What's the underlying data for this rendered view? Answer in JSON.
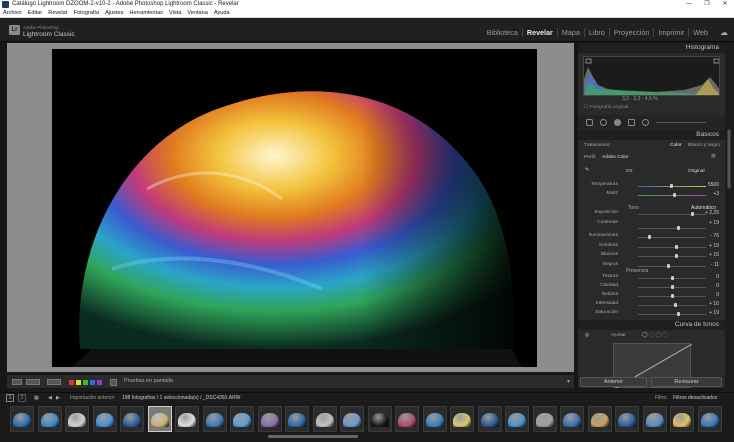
{
  "window": {
    "title": "Catálogo Lightroom DZOOM-2-v10-2 - Adobe Photoshop Lightroom Classic - Revelar",
    "controls": [
      "—",
      "❐",
      "✕"
    ]
  },
  "menu": [
    "Archivo",
    "Editar",
    "Revelar",
    "Fotografía",
    "Ajustes",
    "Herramientas",
    "Vista",
    "Ventana",
    "Ayuda"
  ],
  "identity": {
    "logo": "Lr",
    "vendor": "Adobe Photoshop",
    "product": "Lightroom Classic"
  },
  "modules": [
    {
      "label": "Biblioteca",
      "active": false
    },
    {
      "label": "Revelar",
      "active": true
    },
    {
      "label": "Mapa",
      "active": false
    },
    {
      "label": "Libro",
      "active": false
    },
    {
      "label": "Proyección",
      "active": false
    },
    {
      "label": "Imprimir",
      "active": false
    },
    {
      "label": "Web",
      "active": false
    }
  ],
  "histogram": {
    "title": "Histograma",
    "readout": "3,2   ·   3,3   ·   4,5 %",
    "original_photo": "Fotografía original"
  },
  "basic": {
    "title": "Básicos",
    "treatment_label": "Tratamiento:",
    "treatment_color": "Color",
    "treatment_bw": "Blanco y negro",
    "profile_label": "Perfil:",
    "profile_value": "Adobe Color",
    "wb_label": "EB:",
    "wb_value": "Original",
    "temp_label": "Temperatura",
    "temp_value": "5500",
    "tint_label": "Matiz",
    "tint_value": "+3",
    "tone_label": "Tono",
    "auto_label": "Automático",
    "presence_label": "Presencia"
  },
  "tone_sliders": [
    {
      "label": "Exposición",
      "value": "+ 2,25",
      "pos": 0.82
    },
    {
      "label": "Contraste",
      "value": "+ 19",
      "pos": 0.6
    },
    {
      "label": "Iluminaciones",
      "value": "- 76",
      "pos": 0.15
    },
    {
      "label": "Sombras",
      "value": "+ 15",
      "pos": 0.57
    },
    {
      "label": "Blancos",
      "value": "+ 15",
      "pos": 0.57
    },
    {
      "label": "Negros",
      "value": "- 11",
      "pos": 0.45
    }
  ],
  "presence_sliders": [
    {
      "label": "Textura",
      "value": "0",
      "pos": 0.5
    },
    {
      "label": "Claridad",
      "value": "0",
      "pos": 0.5
    },
    {
      "label": "Neblina",
      "value": "0",
      "pos": 0.5
    },
    {
      "label": "Intensidad",
      "value": "+ 10",
      "pos": 0.55
    },
    {
      "label": "Saturación",
      "value": "+ 19",
      "pos": 0.6
    }
  ],
  "tone_curve": {
    "title": "Curva de tonos",
    "adjust_label": "Ajustar"
  },
  "toolbar": {
    "softproof": "Pruebas en pantalla"
  },
  "buttons": {
    "previous": "Anterior",
    "reset": "Restaurar"
  },
  "filmstrip_bar": {
    "pages": [
      "1",
      "2"
    ],
    "source": "Importación anterior",
    "info": "198 fotografías / 1 seleccionada(s) / _DSC4360.ARW",
    "filter_label": "Filtro:",
    "filter_value": "Filtros desactivados"
  },
  "colors": {
    "accent": "#e8e8e8",
    "panel": "#2a2a2a",
    "center_bg": "#8d8d8d",
    "flag_red": "#d33",
    "flag_yellow": "#dd3",
    "flag_green": "#3b3",
    "flag_blue": "#36d",
    "flag_purple": "#93c"
  }
}
